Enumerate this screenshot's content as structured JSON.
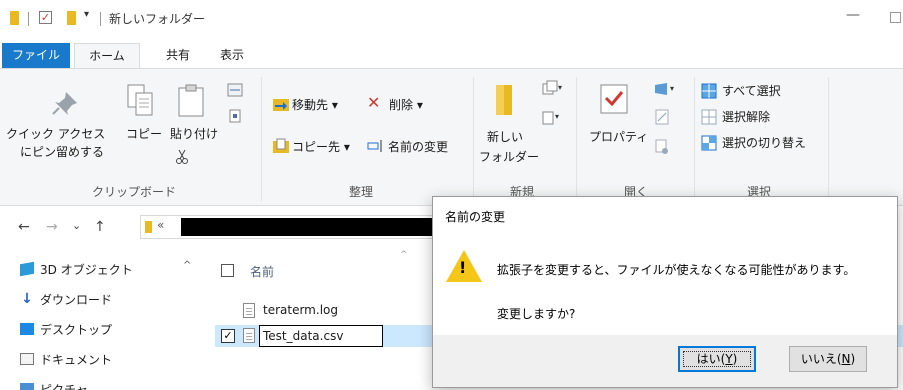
{
  "window": {
    "title": "新しいフォルダー",
    "minimize": "—"
  },
  "quick_access": {
    "dropdown": "▾",
    "check": "✓"
  },
  "tabs": [
    {
      "label": "ファイル"
    },
    {
      "label": "ホーム"
    },
    {
      "label": "共有"
    },
    {
      "label": "表示"
    }
  ],
  "ribbon": {
    "clipboard": {
      "pin_label_1": "クイック アクセス",
      "pin_label_2": "にピン留めする",
      "copy_label": "コピー",
      "paste_label": "貼り付け",
      "group_label": "クリップボード"
    },
    "organize": {
      "move_to": "移動先 ▾",
      "delete": "削除 ▾",
      "copy_to": "コピー先 ▾",
      "rename": "名前の変更",
      "group_label": "整理"
    },
    "new": {
      "new_folder_1": "新しい",
      "new_folder_2": "フォルダー",
      "group_label": "新規"
    },
    "open": {
      "properties": "プロパティ",
      "group_label": "開く"
    },
    "select": {
      "select_all": "すべて選択",
      "select_none": "選択解除",
      "invert": "選択の切り替え",
      "group_label": "選択"
    }
  },
  "nav": {
    "back": "←",
    "forward": "→",
    "recent": "⌄",
    "up": "↑",
    "address_chevron": "«"
  },
  "nav_pane": {
    "items": [
      {
        "label": "3D オブジェクト",
        "icon": "cube-icon",
        "color": "#2a9bd8"
      },
      {
        "label": "ダウンロード",
        "icon": "download-icon",
        "color": "#2563c7"
      },
      {
        "label": "デスクトップ",
        "icon": "desktop-icon",
        "color": "#1e88e5"
      },
      {
        "label": "ドキュメント",
        "icon": "document-icon",
        "color": "#777777"
      },
      {
        "label": "ピクチャ",
        "icon": "pictures-icon",
        "color": "#4a8fd4"
      }
    ],
    "scroll_up": "^"
  },
  "file_list": {
    "column_name": "名前",
    "sort_indicator": "^",
    "files": [
      {
        "name": "teraterm.log",
        "selected": false
      },
      {
        "name": "Test_data.csv",
        "selected": true,
        "renaming": true
      }
    ]
  },
  "dialog": {
    "title": "名前の変更",
    "message": "拡張子を変更すると、ファイルが使えなくなる可能性があります。",
    "question": "変更しますか?",
    "warning_mark": "!",
    "yes_label": "はい(",
    "yes_key": "Y",
    "yes_close": ")",
    "no_label": "いいえ(",
    "no_key": "N",
    "no_close": ")"
  },
  "colors": {
    "accent": "#1979ca",
    "selection": "#cce8ff",
    "warning": "#f5c518",
    "folder": "#e8b923",
    "delete": "#d0392f"
  }
}
